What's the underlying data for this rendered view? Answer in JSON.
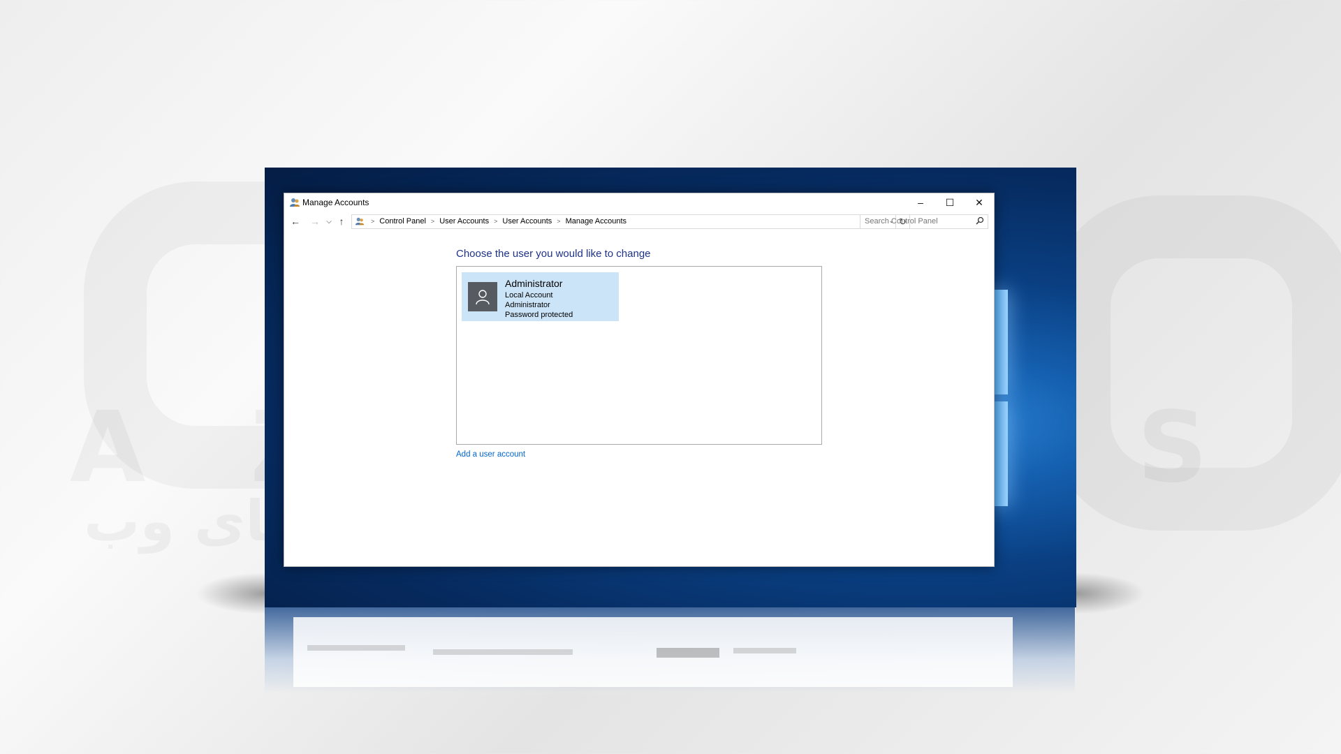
{
  "window": {
    "title": "Manage Accounts",
    "minimize_glyph": "–",
    "maximize_glyph": "☐",
    "close_glyph": "✕"
  },
  "navigation": {
    "back_glyph": "←",
    "forward_glyph": "→",
    "recent_glyph": "⌵",
    "up_glyph": "↑",
    "breadcrumb": [
      "Control Panel",
      "User Accounts",
      "User Accounts",
      "Manage Accounts"
    ],
    "separator": ">",
    "dropdown_glyph": "⌄",
    "refresh_glyph": "↻"
  },
  "search": {
    "placeholder": "Search Control Panel",
    "icon": "search-icon"
  },
  "main": {
    "heading": "Choose the user you would like to change",
    "users": [
      {
        "name": "Administrator",
        "details": [
          "Local Account",
          "Administrator",
          "Password protected"
        ]
      }
    ],
    "add_user_link": "Add a user account"
  },
  "watermark": {
    "latin": "AZARSYS",
    "arabic": "سرعت بی نهایت در دنیای وب"
  },
  "colors": {
    "heading": "#1e3287",
    "link": "#0066cc",
    "selected_card": "#cce4f7",
    "avatar_bg": "#555b61"
  }
}
